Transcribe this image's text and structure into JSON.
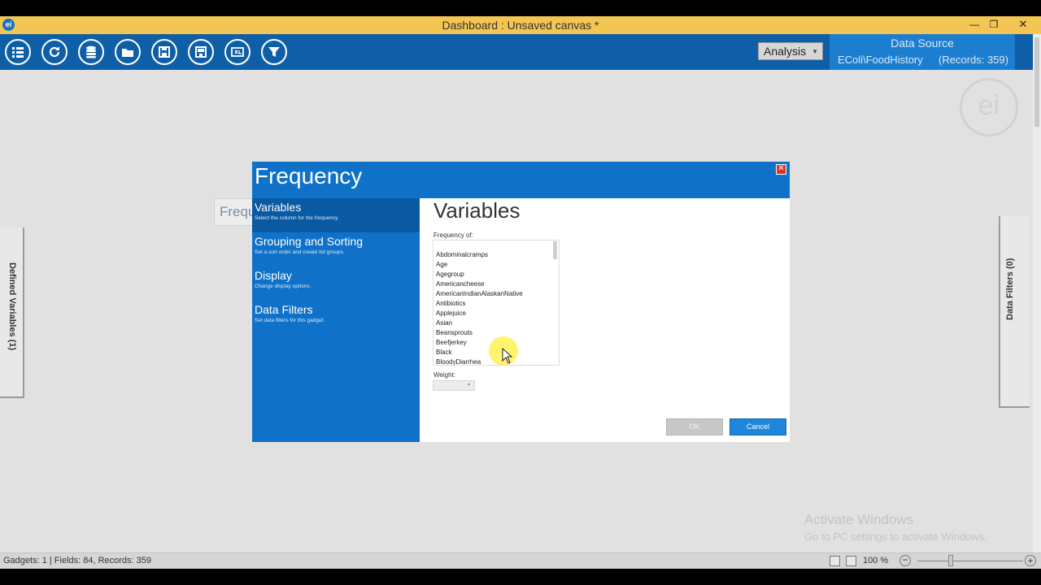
{
  "window": {
    "title": "Dashboard : Unsaved canvas *",
    "app_logo": "ei",
    "controls": [
      "minimize-icon",
      "restore-icon",
      "close-icon"
    ]
  },
  "ribbon": {
    "buttons": [
      "list-icon",
      "refresh-icon",
      "database-icon",
      "open-folder-icon",
      "save-icon",
      "save-as-icon",
      "export-icon",
      "filter-icon"
    ],
    "analysis_select": "Analysis",
    "data_source": {
      "title": "Data Source",
      "name": "EColi\\FoodHistory",
      "records": "(Records: 359)"
    }
  },
  "canvas": {
    "watermark_logo": "ei",
    "gadget_label": "Frequ",
    "left_panel": "Defined Variables (1)",
    "right_panel": "Data Filters (0)"
  },
  "dialog": {
    "title": "Frequency",
    "nav": [
      {
        "label": "Variables",
        "desc": "Select the column for the frequency."
      },
      {
        "label": "Grouping and Sorting",
        "desc": "Set a sort order and create list groups."
      },
      {
        "label": "Display",
        "desc": "Change display options."
      },
      {
        "label": "Data Filters",
        "desc": "Set data filters for this gadget."
      }
    ],
    "content_title": "Variables",
    "frequency_label": "Frequency of:",
    "variables": [
      "Abdominalcramps",
      "Age",
      "Agegroup",
      "Americancheese",
      "AmericanIndianAlaskanNative",
      "Antibiotics",
      "Applejuice",
      "Asian",
      "Beansprouts",
      "Beefjerkey",
      "Black",
      "BloodyDiarrhea"
    ],
    "weight_label": "Weight:",
    "ok_label": "OK",
    "cancel_label": "Cancel"
  },
  "activation": {
    "line1": "Activate Windows",
    "line2": "Go to PC settings to activate Windows."
  },
  "statusbar": {
    "text": "Gadgets: 1 | Fields: 84, Records: 359",
    "zoom": "100 %"
  },
  "colors": {
    "titlebar": "#f3c552",
    "ribbon": "#0f5fa8",
    "dialog": "#0f72c8",
    "cancel_button": "#1e86dc"
  }
}
